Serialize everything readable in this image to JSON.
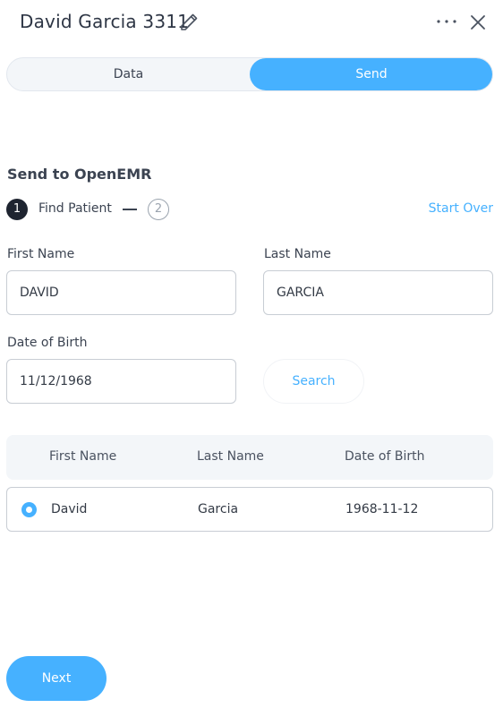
{
  "header": {
    "title": "David Garcia 3311",
    "icons": {
      "edit": "pencil-icon",
      "more": "more-horizontal-icon",
      "close": "close-icon"
    }
  },
  "tabs": [
    {
      "label": "Data",
      "active": false
    },
    {
      "label": "Send",
      "active": true
    }
  ],
  "section": {
    "title": "Send to OpenEMR"
  },
  "stepper": {
    "step1": {
      "number": "1",
      "label": "Find Patient"
    },
    "step2": {
      "number": "2"
    },
    "start_over": "Start Over"
  },
  "form": {
    "first_name": {
      "label": "First Name",
      "value": "DAVID"
    },
    "last_name": {
      "label": "Last Name",
      "value": "GARCIA"
    },
    "dob": {
      "label": "Date of Birth",
      "value": "11/12/1968"
    },
    "search_label": "Search"
  },
  "results": {
    "headers": [
      "First Name",
      "Last Name",
      "Date of Birth"
    ],
    "rows": [
      {
        "first_name": "David",
        "last_name": "Garcia",
        "dob": "1968-11-12",
        "selected": true
      }
    ]
  },
  "footer": {
    "next_label": "Next"
  },
  "colors": {
    "accent": "#46b1ff",
    "dark": "#1e2430",
    "text": "#333a45",
    "border": "#c8cdd4"
  }
}
